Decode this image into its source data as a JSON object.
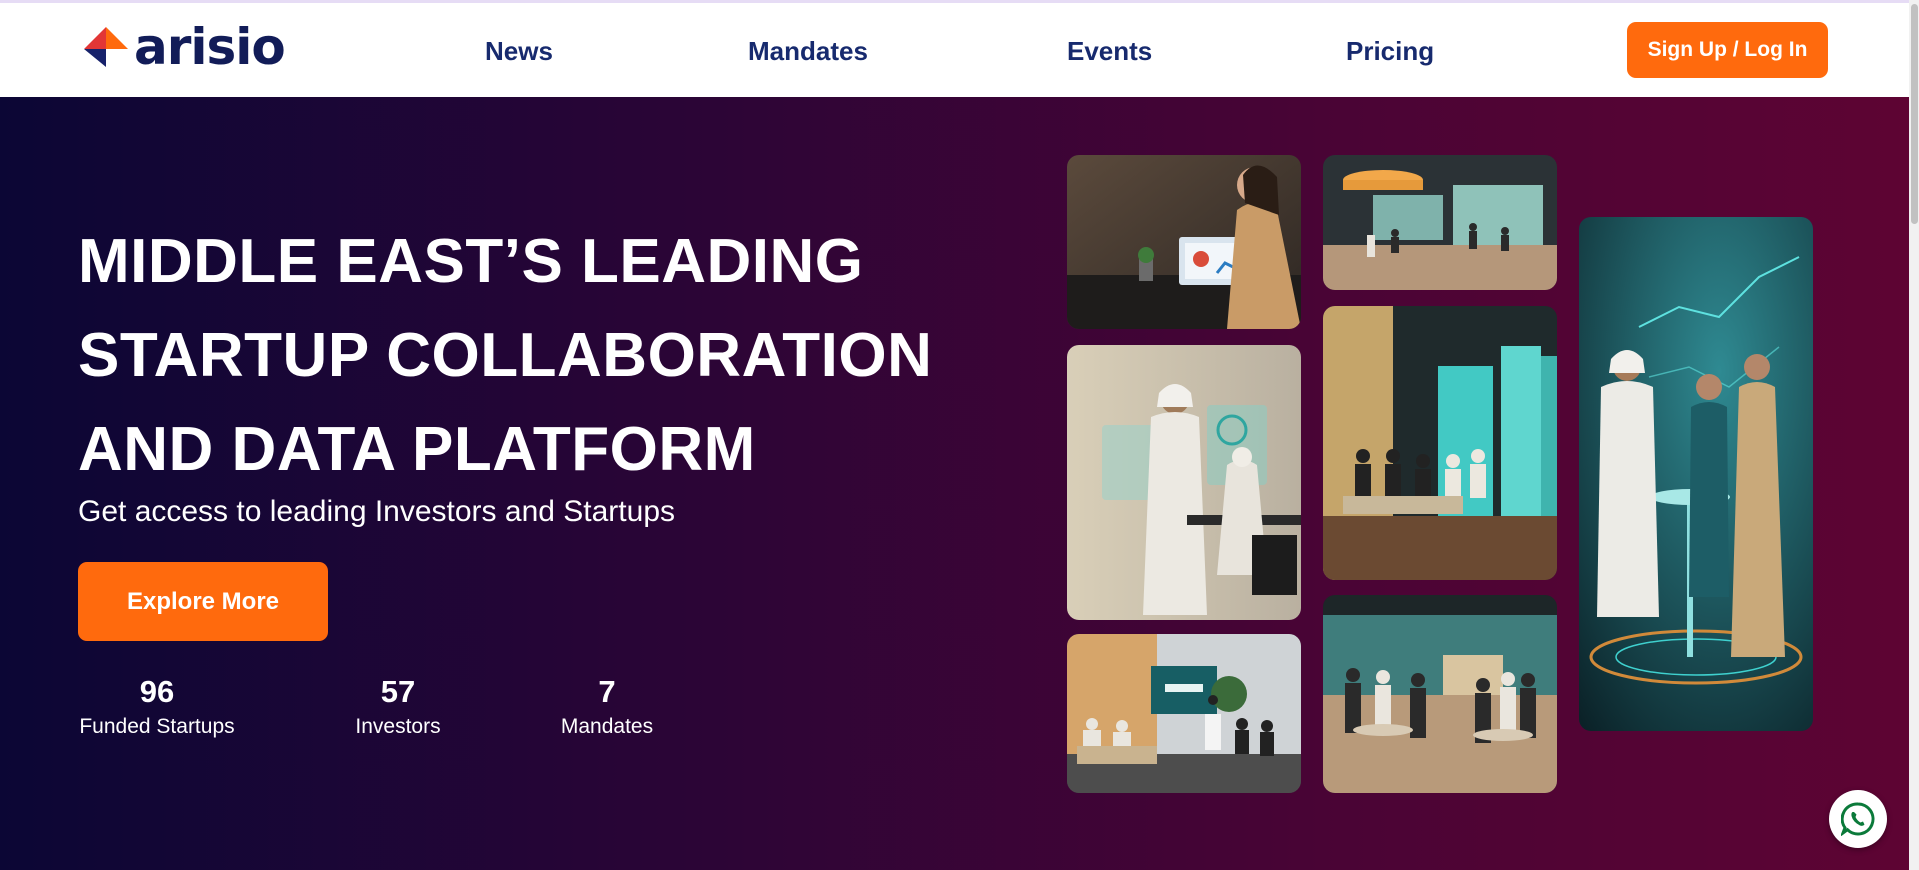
{
  "brand": {
    "logo_text": "arisio",
    "logo_icon": "arisio-diamond-logo",
    "accent": "#ff6a0d",
    "navy": "#172a6e"
  },
  "nav": {
    "items": [
      {
        "label": "News"
      },
      {
        "label": "Mandates"
      },
      {
        "label": "Events"
      },
      {
        "label": "Pricing"
      }
    ],
    "signup_label": "Sign Up / Log In"
  },
  "hero": {
    "headline": [
      "MIDDLE EAST’S LEADING",
      "STARTUP COLLABORATION",
      "AND DATA PLATFORM"
    ],
    "subtitle": "Get access to leading Investors and Startups",
    "cta_label": "Explore More",
    "stats": [
      {
        "value": "96",
        "label": "Funded Startups"
      },
      {
        "value": "57",
        "label": "Investors"
      },
      {
        "value": "7",
        "label": "Mandates"
      }
    ],
    "background_colors": [
      "#0b0635",
      "#5e0433"
    ]
  },
  "gallery": [
    {
      "name": "woman-presenting-on-laptop"
    },
    {
      "name": "exhibition-hall-booths"
    },
    {
      "name": "emirati-man-presenting-hologram"
    },
    {
      "name": "seminar-audience-screens"
    },
    {
      "name": "emirati-trio-at-cocktail-table"
    },
    {
      "name": "startup-panel-discussion"
    },
    {
      "name": "networking-lounge-tables"
    }
  ],
  "chat": {
    "icon": "whatsapp-icon",
    "color": "#25d366"
  }
}
